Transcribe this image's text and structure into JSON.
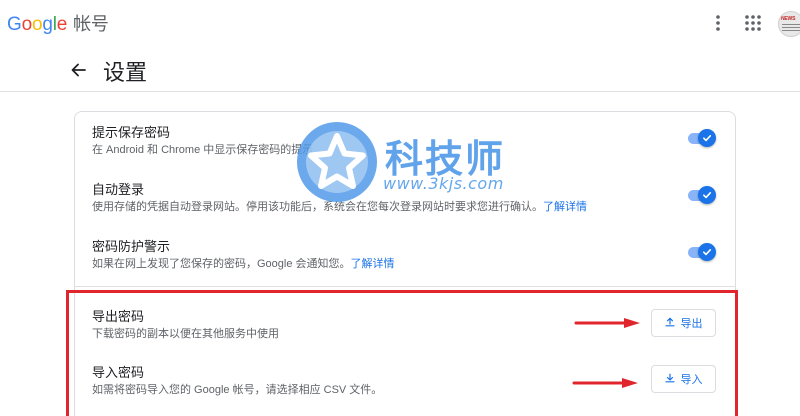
{
  "topbar": {
    "brand_letters": [
      "G",
      "o",
      "o",
      "g",
      "l",
      "e"
    ],
    "product": "帐号",
    "avatar_text": "NEWS",
    "more_icon": "more-vert-icon",
    "apps_icon": "apps-grid-icon"
  },
  "header": {
    "back_icon": "arrow-back-icon",
    "title": "设置"
  },
  "settings": [
    {
      "title": "提示保存密码",
      "description": "在 Android 和 Chrome 中显示保存密码的提示",
      "toggle_on": true
    },
    {
      "title": "自动登录",
      "description": "使用存储的凭据自动登录网站。停用该功能后，系统会在您每次登录网站时要求您进行确认。",
      "link": "了解详情",
      "toggle_on": true
    },
    {
      "title": "密码防护警示",
      "description": "如果在网上发现了您保存的密码，Google 会通知您。",
      "link": "了解详情",
      "toggle_on": true
    }
  ],
  "actions": [
    {
      "title": "导出密码",
      "description": "下载密码的副本以便在其他服务中使用",
      "button_label": "导出",
      "icon": "upload-icon"
    },
    {
      "title": "导入密码",
      "description": "如需将密码导入您的 Google 帐号，请选择相应 CSV 文件。",
      "button_label": "导入",
      "icon": "download-icon"
    }
  ],
  "watermark": {
    "title": "科技师",
    "url": "www.3kjs.com"
  },
  "colors": {
    "accent": "#1a73e8",
    "toggle_track": "#8ab4f8",
    "highlight": "#e0262c",
    "watermark": "#4a96e8"
  }
}
